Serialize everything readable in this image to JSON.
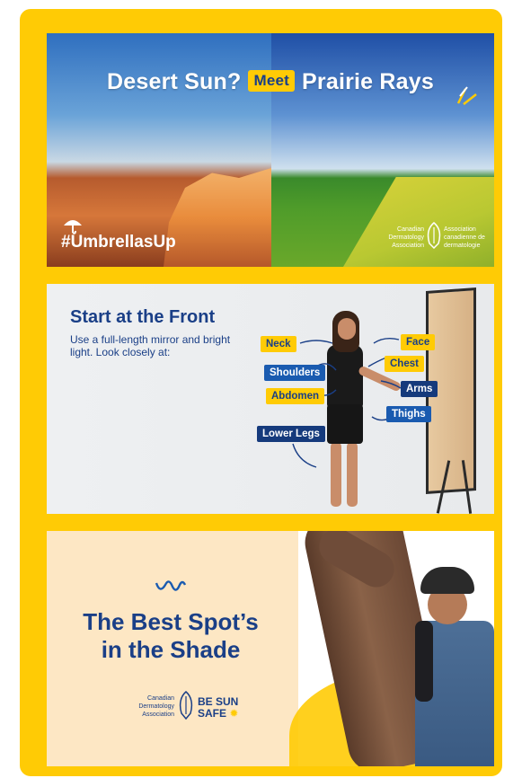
{
  "card1": {
    "title_left": "Desert Sun?",
    "meet": "Meet",
    "title_right": "Prairie Rays",
    "hashtag": "#UmbrellasUp",
    "org_en": [
      "Canadian",
      "Dermatology",
      "Association"
    ],
    "org_fr": [
      "Association",
      "canadienne de",
      "dermatologie"
    ]
  },
  "card2": {
    "title": "Start at the Front",
    "subtitle": "Use a full-length mirror and bright light. Look closely at:",
    "labels": {
      "neck": "Neck",
      "face": "Face",
      "chest": "Chest",
      "shoulders": "Shoulders",
      "abdomen": "Abdomen",
      "arms": "Arms",
      "thighs": "Thighs",
      "lower_legs": "Lower Legs"
    }
  },
  "card3": {
    "title_line1": "The Best Spot’s",
    "title_line2": "in the Shade",
    "org_en": [
      "Canadian",
      "Dermatology",
      "Association"
    ],
    "campaign_line1": "BE SUN",
    "campaign_line2": "SAFE"
  },
  "colors": {
    "frame": "#FFCB05",
    "navy": "#1a3f87",
    "blue_label": "#1a5bb0",
    "yellow_label": "#FFCB05"
  }
}
